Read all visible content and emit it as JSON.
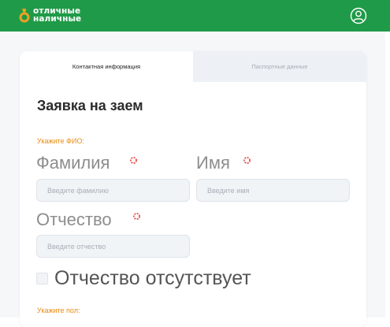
{
  "header": {
    "logo_line1": "отличные",
    "logo_line2": "наличные",
    "brand_color": "#1f9a48",
    "accent_color": "#f0a020",
    "account_icon": "user-circle-icon"
  },
  "tabs": [
    {
      "label": "Контактная информация",
      "active": true
    },
    {
      "label": "Паспортные данные",
      "active": false
    }
  ],
  "form": {
    "title": "Заявка на заем",
    "fio_section_label": "Укажите ФИО:",
    "lastname": {
      "label": "Фамилия",
      "placeholder": "Введите фамилию",
      "value": ""
    },
    "firstname": {
      "label": "Имя",
      "placeholder": "Введите имя",
      "value": ""
    },
    "patronymic": {
      "label": "Отчество",
      "placeholder": "Введите отчество",
      "value": ""
    },
    "no_patronymic_label": "Отчество отсутствует",
    "no_patronymic_checked": false,
    "gender_section_label": "Укажите пол:",
    "required_color": "#e53935",
    "section_label_color": "#e98a12"
  }
}
